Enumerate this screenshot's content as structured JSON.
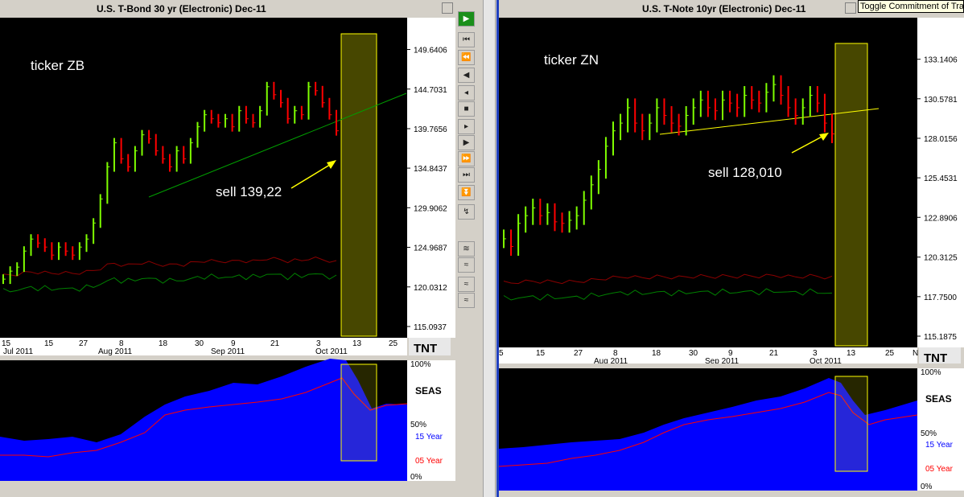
{
  "left": {
    "title": "U.S. T-Bond 30 yr (Electronic) Dec-11",
    "ticker_label": "ticker ZB",
    "sell_label": "sell 139,22",
    "price_ticks": [
      "149.6406",
      "144.7031",
      "139.7656",
      "134.8437",
      "129.9062",
      "124.9687",
      "120.0312",
      "115.0937"
    ],
    "date_ticks": [
      "15",
      "15",
      "27",
      "8",
      "18",
      "30",
      "9",
      "21",
      "3",
      "13",
      "25"
    ],
    "month_labels": [
      "Jul 2011",
      "Aug 2011",
      "Sep 2011",
      "Oct 2011"
    ],
    "seas_label": "SEAS",
    "pct_ticks": [
      "100%",
      "50%",
      "0%"
    ],
    "legend_15": "15 Year",
    "legend_05": "05 Year",
    "logo": "TNT"
  },
  "right": {
    "title": "U.S. T-Note 10yr (Electronic) Dec-11",
    "ticker_label": "ticker ZN",
    "sell_label": "sell 128,010",
    "price_ticks": [
      "133.1406",
      "130.5781",
      "128.0156",
      "125.4531",
      "122.8906",
      "120.3125",
      "117.7500",
      "115.1875"
    ],
    "date_ticks": [
      "5",
      "15",
      "27",
      "8",
      "18",
      "30",
      "9",
      "21",
      "3",
      "13",
      "25",
      "N"
    ],
    "month_labels": [
      "Aug 2011",
      "Sep 2011",
      "Oct 2011"
    ],
    "seas_label": "SEAS",
    "pct_ticks": [
      "100%",
      "50%",
      "0%"
    ],
    "legend_15": "15 Year",
    "legend_05": "05 Year",
    "logo": "TNT"
  },
  "tooltip": "Toggle Commitment of Traders",
  "colors": {
    "up": "#7fff00",
    "down": "#ff0000",
    "seas_fill": "#0000ff",
    "seas_line": "#ff0000",
    "highlight": "#ffff00",
    "trend_left": "#00a000",
    "trend_right": "#ffff00",
    "arrow": "#ffff00",
    "bg": "#000000",
    "axis_bg": "#ffffff",
    "red_indicator": "#8b0000",
    "green_indicator": "#008000"
  },
  "chart_data": [
    {
      "type": "ohlc",
      "title": "U.S. T-Bond 30 yr (Electronic) Dec-11",
      "ylim": [
        115.0937,
        152.0
      ],
      "x": [
        "Jul 2011",
        "Aug 2011",
        "Sep 2011",
        "Oct 2011"
      ],
      "close": [
        121.0,
        122.0,
        122.5,
        124.5,
        126.0,
        125.5,
        125.0,
        124.0,
        125.0,
        124.5,
        124.0,
        125.0,
        126.0,
        128.0,
        131.0,
        135.0,
        138.0,
        136.0,
        135.0,
        137.0,
        139.0,
        138.5,
        137.0,
        136.0,
        135.0,
        137.0,
        136.0,
        138.0,
        140.0,
        141.5,
        141.0,
        140.5,
        141.0,
        140.0,
        142.0,
        141.0,
        140.5,
        142.0,
        145.0,
        144.0,
        143.0,
        141.0,
        142.0,
        141.5,
        145.0,
        144.5,
        143.0,
        141.5,
        139.5
      ]
    },
    {
      "type": "ohlc",
      "title": "U.S. T-Note 10yr (Electronic) Dec-11",
      "ylim": [
        115.1875,
        135.0
      ],
      "x": [
        "Aug 2011",
        "Sep 2011",
        "Oct 2011"
      ],
      "close": [
        121.5,
        121.0,
        122.5,
        123.0,
        123.5,
        123.0,
        123.2,
        122.6,
        122.5,
        122.7,
        123.0,
        124.0,
        125.0,
        126.0,
        127.5,
        128.5,
        129.0,
        130.0,
        129.0,
        128.5,
        129.0,
        130.0,
        129.5,
        129.0,
        128.8,
        129.5,
        130.0,
        130.5,
        130.0,
        129.8,
        130.5,
        130.3,
        130.0,
        130.8,
        130.5,
        130.3,
        131.0,
        131.5,
        130.8,
        130.0,
        129.5,
        130.0,
        130.8,
        130.3,
        129.0,
        128.3
      ]
    }
  ]
}
